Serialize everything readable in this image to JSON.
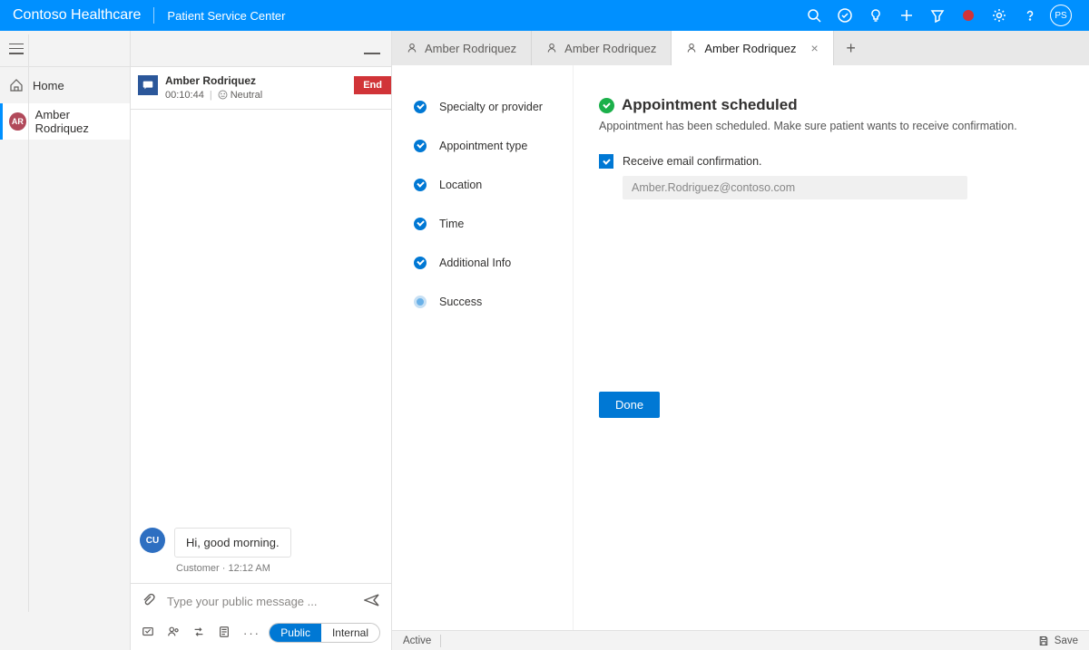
{
  "topbar": {
    "brand": "Contoso Healthcare",
    "module": "Patient Service Center",
    "user_initials": "PS"
  },
  "nav": {
    "home_label": "Home",
    "patient_initials": "AR",
    "patient_label": "Amber Rodriquez"
  },
  "session": {
    "name": "Amber Rodriquez",
    "timer": "00:10:44",
    "sentiment": "Neutral",
    "end_label": "End"
  },
  "chat": {
    "msg_avatar": "CU",
    "msg_text": "Hi, good morning.",
    "msg_meta": "Customer · 12:12 AM",
    "placeholder": "Type your public message ...",
    "pill_public": "Public",
    "pill_internal": "Internal"
  },
  "tabs": [
    {
      "label": "Amber Rodriquez"
    },
    {
      "label": "Amber Rodriquez"
    },
    {
      "label": "Amber Rodriquez",
      "active": true
    }
  ],
  "steps": {
    "s1": "Specialty or provider",
    "s2": "Appointment type",
    "s3": "Location",
    "s4": "Time",
    "s5": "Additional Info",
    "s6": "Success"
  },
  "panel": {
    "title": "Appointment scheduled",
    "subtitle": "Appointment has been scheduled. Make sure patient wants to receive confirmation.",
    "checkbox_label": "Receive email confirmation.",
    "email": "Amber.Rodriguez@contoso.com",
    "done_label": "Done"
  },
  "status": {
    "state": "Active",
    "save": "Save"
  }
}
